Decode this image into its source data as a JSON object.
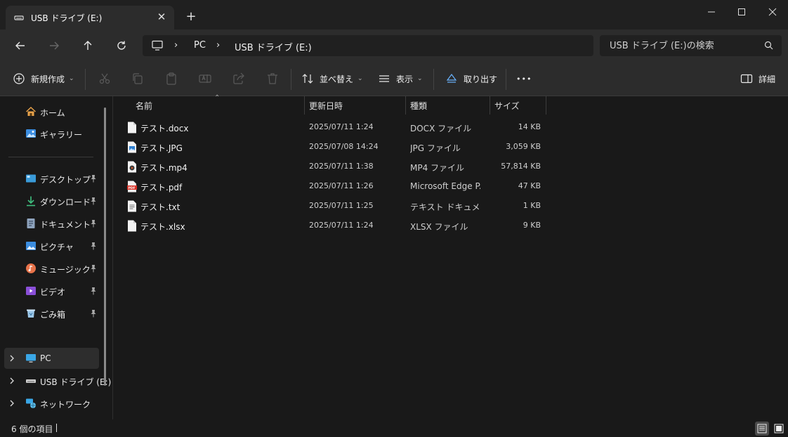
{
  "tab": {
    "title": "USB ドライブ (E:)",
    "close": "✕",
    "new": "+"
  },
  "breadcrumb": {
    "items": [
      "PC",
      "USB ドライブ (E:)"
    ],
    "separator": "›"
  },
  "search": {
    "placeholder": "USB ドライブ (E:)の検索"
  },
  "toolbar": {
    "new_label": "新規作成",
    "sort_label": "並べ替え",
    "view_label": "表示",
    "eject_label": "取り出す",
    "more_label": "•••",
    "details_label": "詳細"
  },
  "sidebar": {
    "quick": [
      {
        "label": "ホーム",
        "icon": "home-icon"
      },
      {
        "label": "ギャラリー",
        "icon": "gallery-icon"
      }
    ],
    "pinned": [
      {
        "label": "デスクトップ",
        "icon": "desktop-icon"
      },
      {
        "label": "ダウンロード",
        "icon": "download-icon"
      },
      {
        "label": "ドキュメント",
        "icon": "document-icon"
      },
      {
        "label": "ピクチャ",
        "icon": "pictures-icon"
      },
      {
        "label": "ミュージック",
        "icon": "music-icon"
      },
      {
        "label": "ビデオ",
        "icon": "video-icon"
      },
      {
        "label": "ごみ箱",
        "icon": "recycle-bin-icon"
      }
    ],
    "devices": [
      {
        "label": "PC",
        "icon": "pc-icon"
      },
      {
        "label": "USB ドライブ (E:)",
        "icon": "usb-drive-icon"
      },
      {
        "label": "ネットワーク",
        "icon": "network-icon"
      }
    ]
  },
  "columns": {
    "name": "名前",
    "date": "更新日時",
    "type": "種類",
    "size": "サイズ"
  },
  "files": [
    {
      "name": "テスト.docx",
      "date": "2025/07/11 1:24",
      "type": "DOCX ファイル",
      "size": "14 KB",
      "icon": "docx-file-icon"
    },
    {
      "name": "テスト.JPG",
      "date": "2025/07/08 14:24",
      "type": "JPG ファイル",
      "size": "3,059 KB",
      "icon": "jpg-file-icon"
    },
    {
      "name": "テスト.mp4",
      "date": "2025/07/11 1:38",
      "type": "MP4 ファイル",
      "size": "57,814 KB",
      "icon": "mp4-file-icon"
    },
    {
      "name": "テスト.pdf",
      "date": "2025/07/11 1:26",
      "type": "Microsoft Edge P...",
      "size": "47 KB",
      "icon": "pdf-file-icon"
    },
    {
      "name": "テスト.txt",
      "date": "2025/07/11 1:25",
      "type": "テキスト ドキュメント",
      "size": "1 KB",
      "icon": "txt-file-icon"
    },
    {
      "name": "テスト.xlsx",
      "date": "2025/07/11 1:24",
      "type": "XLSX ファイル",
      "size": "9 KB",
      "icon": "xlsx-file-icon"
    }
  ],
  "status": {
    "count": "6 個の項目"
  }
}
